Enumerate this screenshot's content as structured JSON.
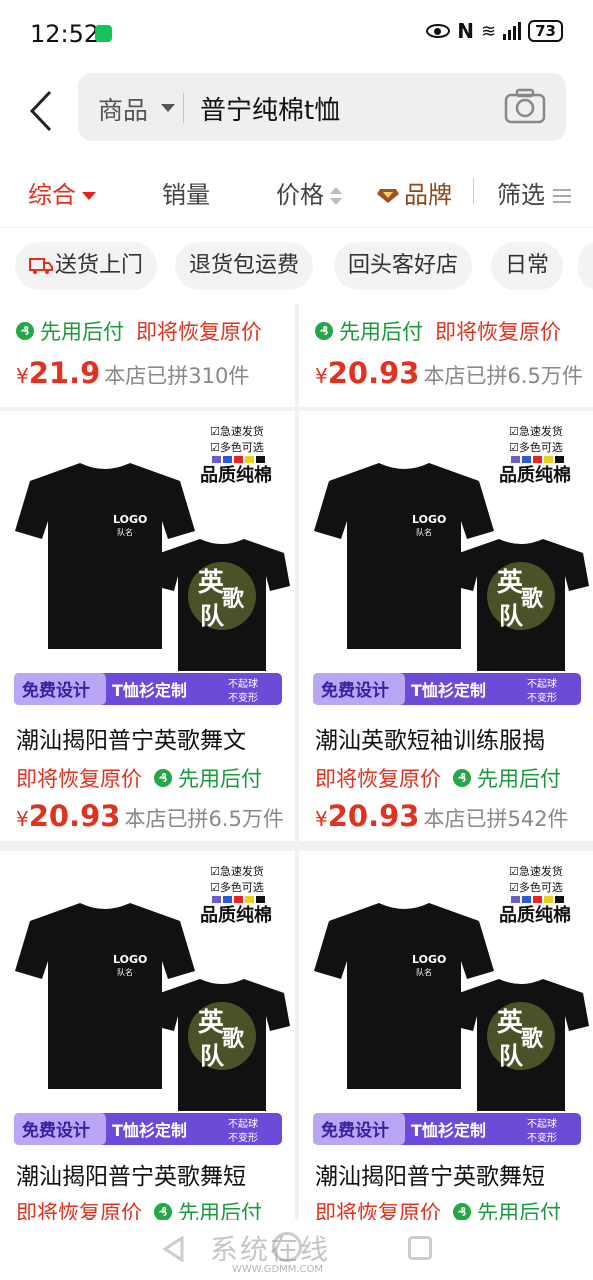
{
  "status_bar": {
    "time": "12:52",
    "battery": "73"
  },
  "search": {
    "scope": "商品",
    "query": "普宁纯棉t恤"
  },
  "sort_tabs": [
    {
      "label": "综合",
      "active": true
    },
    {
      "label": "销量"
    },
    {
      "label": "价格"
    },
    {
      "label": "品牌"
    },
    {
      "label": "筛选"
    }
  ],
  "chips": [
    "送货上门",
    "退货包运费",
    "回头客好店",
    "日常"
  ],
  "products": [
    {
      "promo_pay": "先用后付",
      "promo_restore": "即将恢复原价",
      "price": "21.9",
      "sold": "本店已拼310件"
    },
    {
      "promo_pay": "先用后付",
      "promo_restore": "即将恢复原价",
      "price": "20.93",
      "sold": "本店已拼6.5万件"
    },
    {
      "title": "潮汕揭阳普宁英歌舞文",
      "promo_restore": "即将恢复原价",
      "promo_pay": "先用后付",
      "price": "20.93",
      "sold": "本店已拼6.5万件"
    },
    {
      "title": "潮汕英歌短袖训练服揭",
      "promo_restore": "即将恢复原价",
      "promo_pay": "先用后付",
      "price": "20.93",
      "sold": "本店已拼542件"
    },
    {
      "title": "潮汕揭阳普宁英歌舞短",
      "promo_restore": "即将恢复原价",
      "promo_pay": "先用后付"
    },
    {
      "title": "潮汕揭阳普宁英歌舞短",
      "promo_restore": "即将恢复原价",
      "promo_pay": "先用后付"
    }
  ],
  "product_image": {
    "badge_1": "☑急速发货",
    "badge_2": "☑多色可选",
    "badge_quality": "品质纯棉",
    "shirt_logo": "LOGO",
    "shirt_team": "队名",
    "back_char_1": "英",
    "back_char_2": "歌",
    "back_char_3": "队",
    "banner_free": "免费设计",
    "banner_custom": "T恤衫定制",
    "banner_note_1": "不起球",
    "banner_note_2": "不变形"
  },
  "currency": "¥",
  "watermark": {
    "text": "系统在线",
    "url": "WWW.GDMM.COM"
  },
  "colors": {
    "accent_red": "#e0321e",
    "pay_green": "#1a9a3c",
    "banner_purple": "#6c4bd8"
  },
  "icons": [
    "back-arrow-icon",
    "camera-icon",
    "diamond-icon",
    "truck-icon",
    "pay-later-icon"
  ]
}
